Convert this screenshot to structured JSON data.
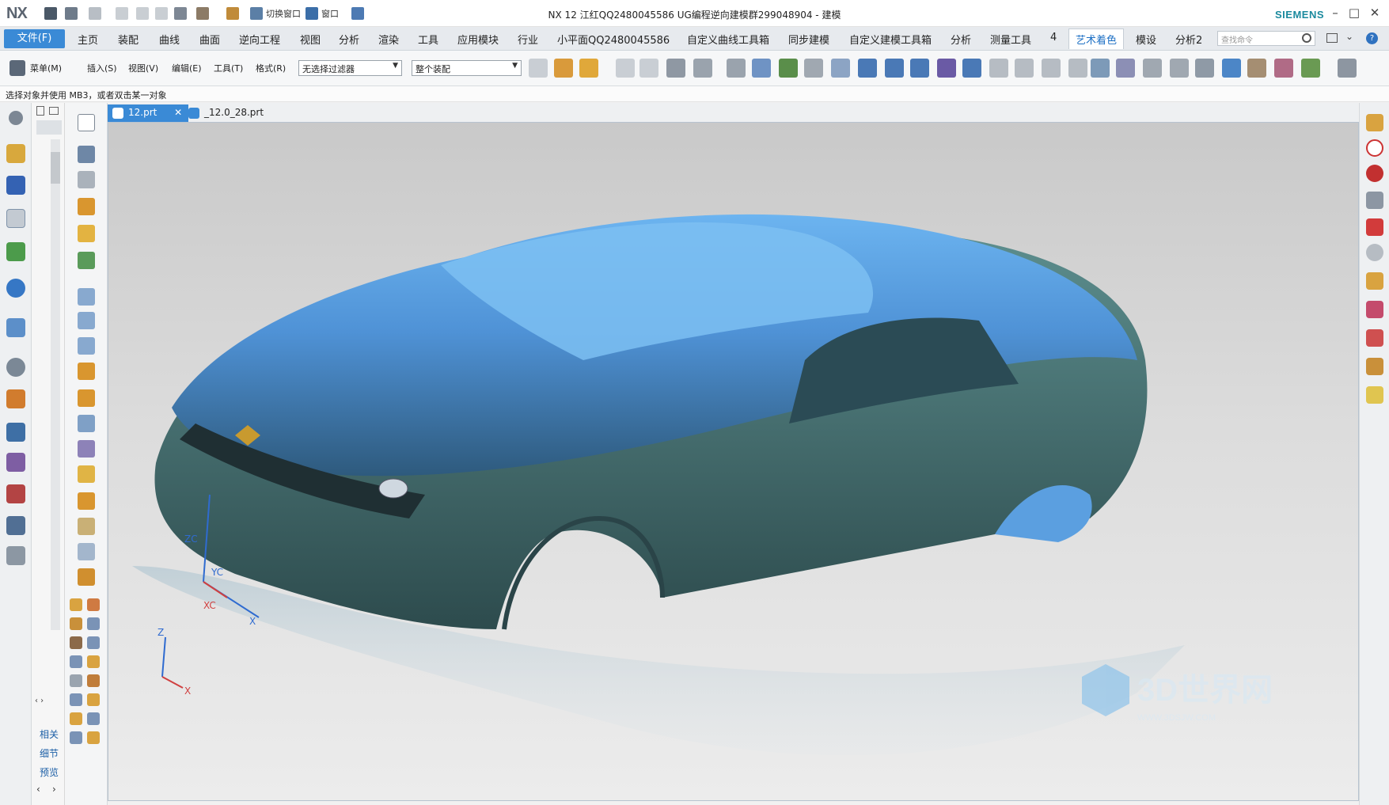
{
  "app": {
    "logo": "NX",
    "window_title": "NX 12  江红QQ2480045586 UG编程逆向建模群299048904 - 建模",
    "brand": "SIEMENS",
    "window_controls": [
      "–",
      "□",
      "✕"
    ]
  },
  "quick_access": {
    "switch_window": "切换窗口",
    "window": "窗口"
  },
  "menubar": {
    "file": "文件(F)",
    "items": [
      "主页",
      "装配",
      "曲线",
      "曲面",
      "逆向工程",
      "视图",
      "分析",
      "渲染",
      "工具",
      "应用模块",
      "行业",
      "小平面QQ2480045586",
      "自定义曲线工具箱",
      "同步建模",
      "自定义建模工具箱",
      "分析",
      "测量工具",
      "4",
      "艺术着色",
      "模设",
      "分析2"
    ],
    "active_index": 18,
    "search_placeholder": "查找命令"
  },
  "ribbon": {
    "menu": "菜单(M)",
    "insert": "插入(S)",
    "view": "视图(V)",
    "edit": "编辑(E)",
    "tools": "工具(T)",
    "format": "格式(R)",
    "filter_value": "无选择过滤器",
    "scope_value": "整个装配"
  },
  "cue_line": "选择对象并使用 MB3，或者双击某一对象",
  "navigator": {
    "bottom_tabs": [
      "相关",
      "细节",
      "预览"
    ],
    "scroll_arrows": [
      "‹",
      "›"
    ]
  },
  "file_tabs": [
    {
      "label": "12.prt",
      "active": true,
      "modified_mark": "✕"
    },
    {
      "label": "_12.0_28.prt",
      "active": false
    }
  ],
  "viewport": {
    "triad_labels": {
      "zc": "ZC",
      "yc": "YC",
      "xc": "XC",
      "x": "X"
    },
    "abs_triad_labels": {
      "z": "Z",
      "x": "X"
    },
    "watermark": "3D世界网",
    "watermark_url": "WWW.3DSJW.COM"
  },
  "colors": {
    "accent": "#3a8ad6",
    "car_body": "#5a9fe0",
    "car_shadow": "#3e6a6e",
    "viewport_bg": "#d6d6d6"
  }
}
